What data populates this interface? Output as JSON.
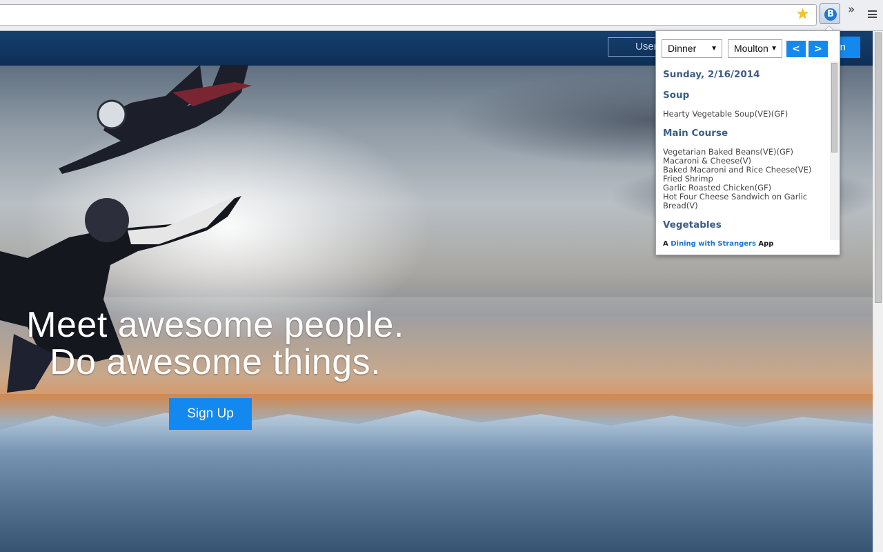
{
  "browser": {
    "extension_letter": "B",
    "overflow_chevron": "»"
  },
  "site": {
    "username_placeholder": "User",
    "login_label": "gin",
    "headline_line1": "Meet awesome people.",
    "headline_line2": "Do awesome things.",
    "signup_label": "Sign Up"
  },
  "popup": {
    "meal_select": "Dinner",
    "hall_select": "Moulton",
    "prev_label": "<",
    "next_label": ">",
    "date": "Sunday, 2/16/2014",
    "sections": [
      {
        "title": "Soup",
        "items": [
          "Hearty Vegetable Soup(VE)(GF)"
        ]
      },
      {
        "title": "Main Course",
        "items": [
          "Vegetarian Baked Beans(VE)(GF)",
          "Macaroni & Cheese(V)",
          "Baked Macaroni and Rice Cheese(VE)",
          "Fried Shrimp",
          "Garlic Roasted Chicken(GF)",
          "Hot Four Cheese Sandwich on Garlic Bread(V)"
        ]
      },
      {
        "title": "Vegetables",
        "items": []
      }
    ],
    "footer_prefix": "A",
    "footer_link": "Dining with Strangers",
    "footer_suffix": "App"
  },
  "colors": {
    "accent": "#1389f0",
    "nav_bar": "#0d2f57",
    "popup_heading": "#3d5d86"
  }
}
